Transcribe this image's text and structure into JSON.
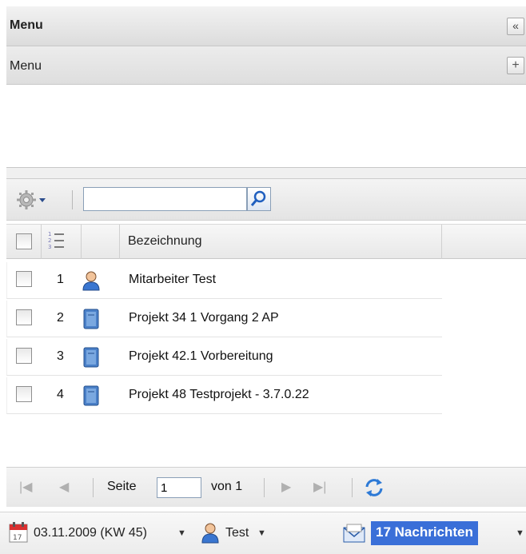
{
  "panel": {
    "title": "Menu",
    "collapse_glyph": "«",
    "submenu_title": "Menu",
    "expand_glyph": "+"
  },
  "toolbar": {
    "gear_icon": "gear-icon",
    "search_value": "",
    "search_icon": "magnifier-icon"
  },
  "grid": {
    "columns": [
      "",
      "",
      "Bezeichnung"
    ],
    "rows": [
      {
        "num": "1",
        "icon": "person-icon",
        "label": "Mitarbeiter Test"
      },
      {
        "num": "2",
        "icon": "book-icon",
        "label": "Projekt 34 1 Vorgang 2 AP"
      },
      {
        "num": "3",
        "icon": "book-icon",
        "label": "Projekt 42.1 Vorbereitung"
      },
      {
        "num": "4",
        "icon": "book-icon",
        "label": "Projekt 48 Testprojekt - 3.7.0.22"
      }
    ]
  },
  "pager": {
    "page_label": "Seite",
    "page_value": "1",
    "of_label": "von 1"
  },
  "statusbar": {
    "date": "03.11.2009 (KW 45)",
    "user": "Test",
    "messages": "17 Nachrichten",
    "accent": "#3a6fd8"
  }
}
